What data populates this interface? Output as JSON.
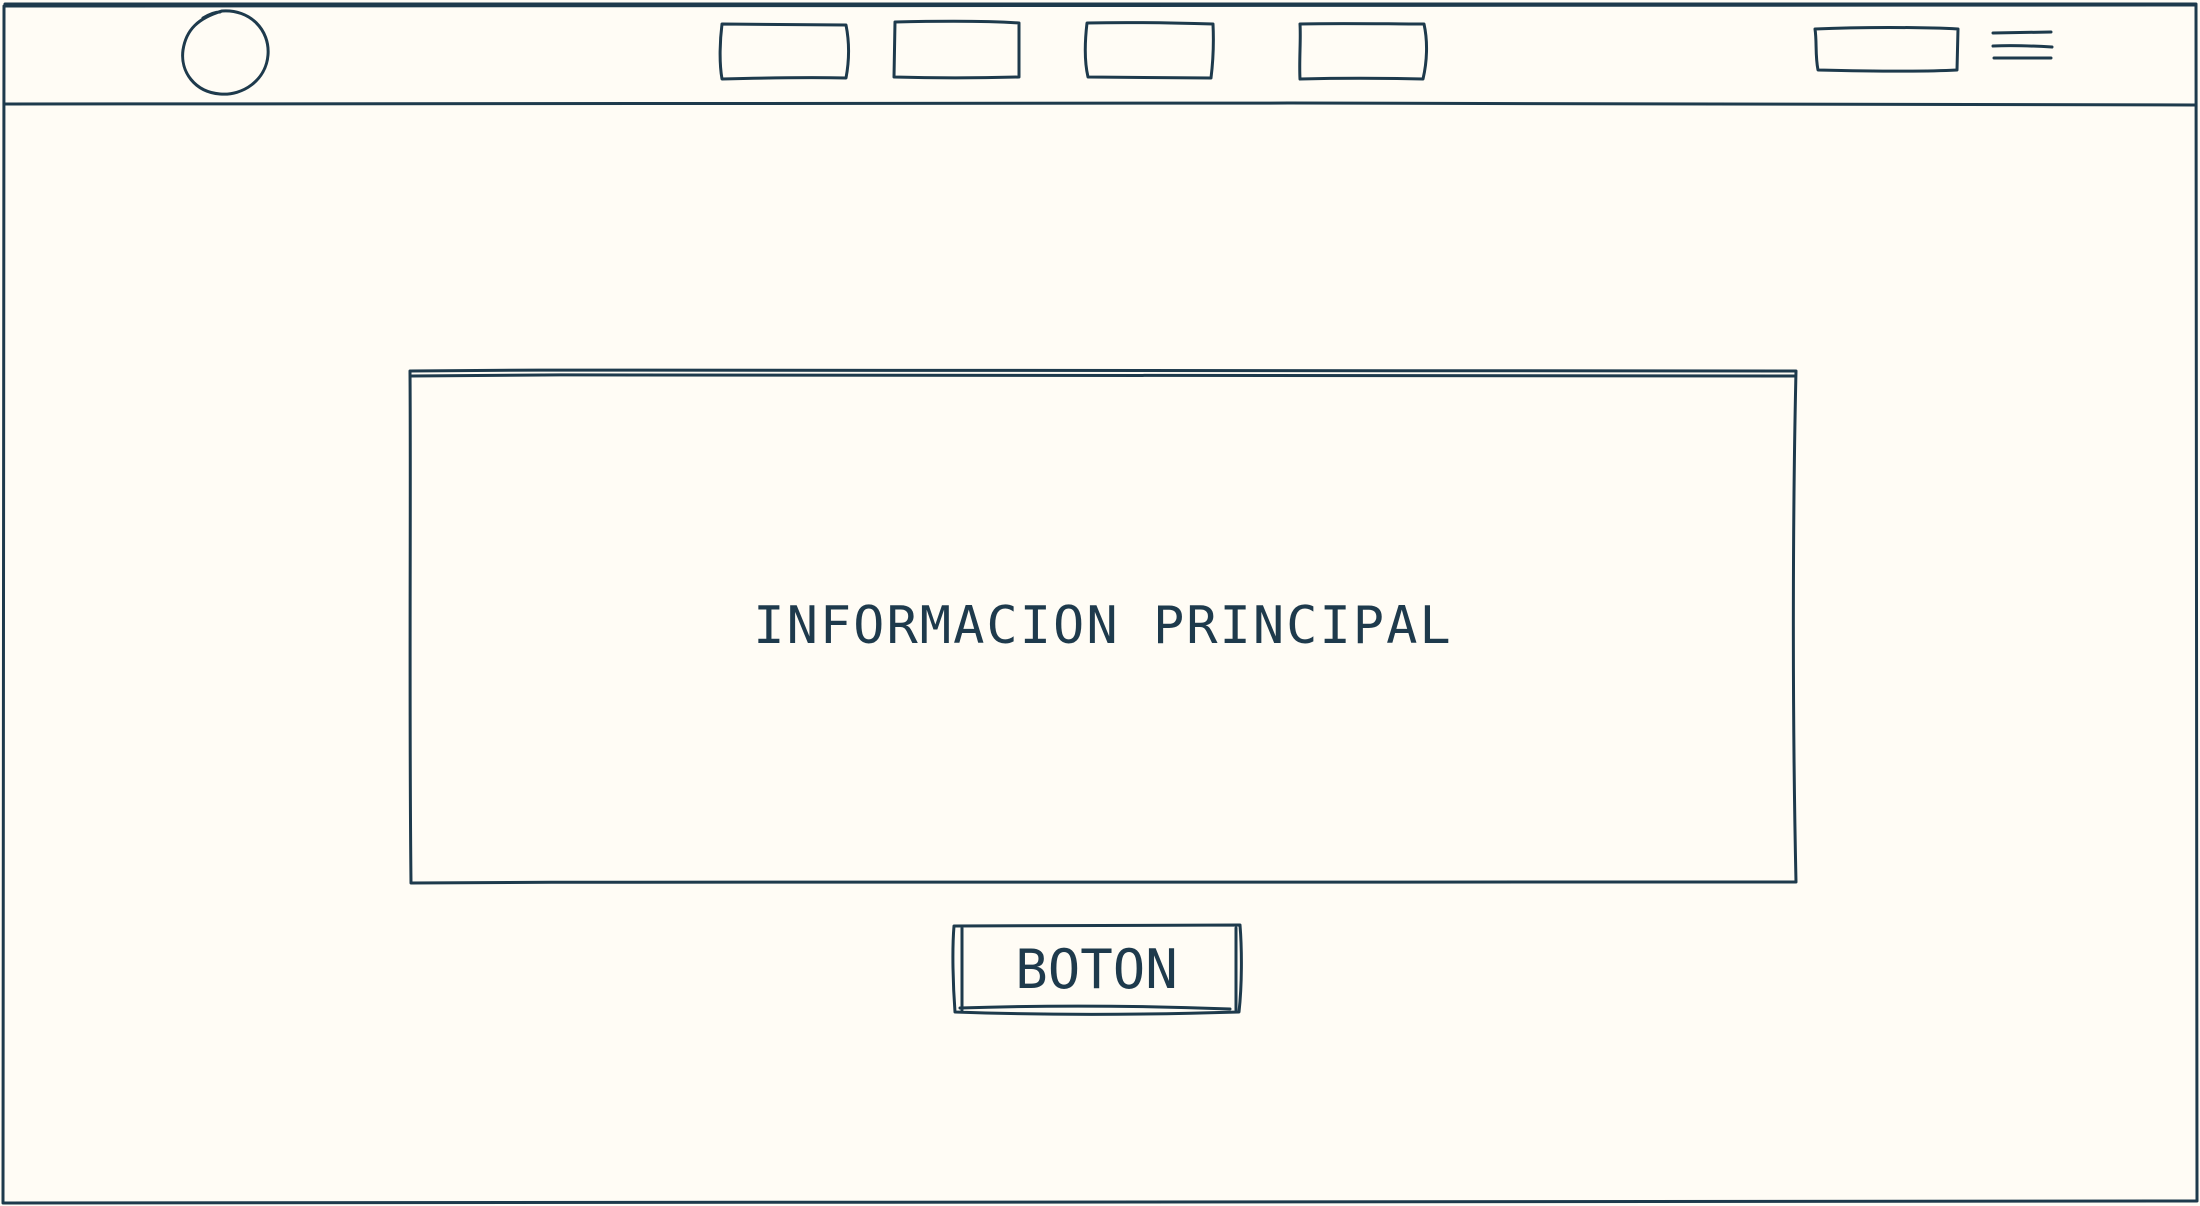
{
  "colors": {
    "background": "#fffcf5",
    "ink": "#1e3a4c"
  },
  "header": {
    "logo_icon": "circle-logo-icon",
    "nav_items": 4,
    "has_action_button": true,
    "menu_icon": "hamburger-menu-icon"
  },
  "main": {
    "info_label": "INFORMACION PRINCIPAL",
    "button_label": "BOTON"
  }
}
